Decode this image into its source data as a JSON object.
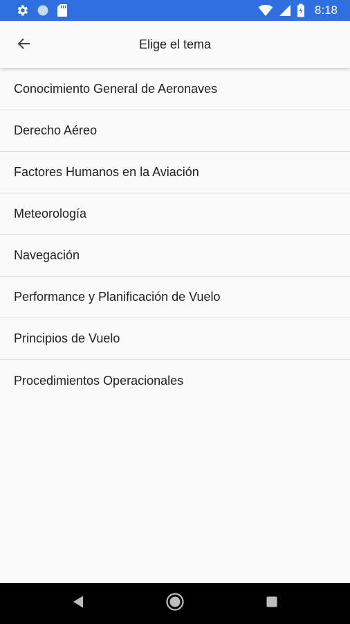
{
  "status_bar": {
    "time": "8:18",
    "color": "#2f6fe0",
    "left_icons": [
      "settings-icon",
      "circle-icon",
      "sd-card-icon"
    ],
    "right_icons": [
      "wifi-icon",
      "signal-icon",
      "battery-icon"
    ]
  },
  "app_bar": {
    "title": "Elige el tema",
    "back_icon": "arrow-back-icon"
  },
  "topics": [
    {
      "label": "Conocimiento General de Aeronaves"
    },
    {
      "label": "Derecho Aéreo"
    },
    {
      "label": "Factores Humanos en la Aviación"
    },
    {
      "label": "Meteorología"
    },
    {
      "label": "Navegación"
    },
    {
      "label": "Performance y Planificación de Vuelo"
    },
    {
      "label": "Principios de Vuelo"
    },
    {
      "label": "Procedimientos Operacionales"
    }
  ],
  "nav_bar": {
    "buttons": [
      "back-triangle-icon",
      "home-circle-icon",
      "recents-square-icon"
    ]
  }
}
